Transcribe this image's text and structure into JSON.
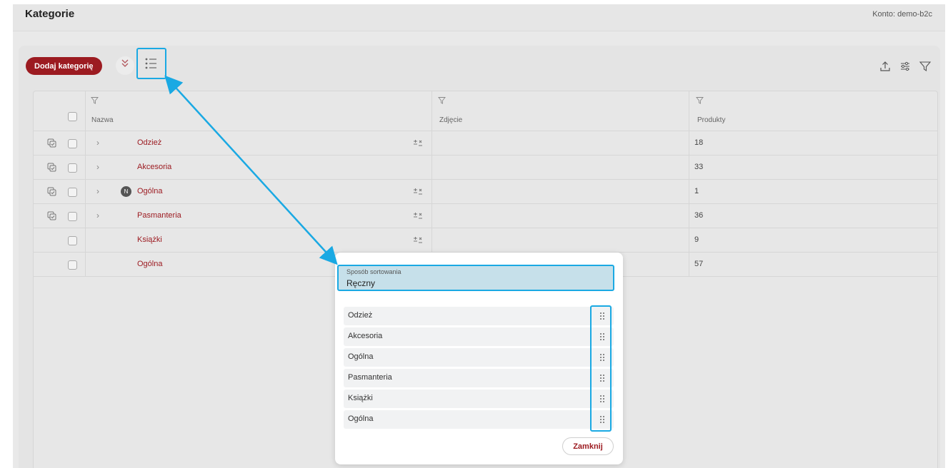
{
  "header": {
    "title": "Kategorie",
    "account": "Konto: demo-b2c"
  },
  "toolbar": {
    "add_label": "Dodaj kategorię",
    "icons": [
      "double-chevron-down-icon",
      "sort-list-icon",
      "upload-icon",
      "sliders-icon",
      "filter-icon"
    ]
  },
  "table": {
    "columns": [
      "Nazwa",
      "Zdjęcie",
      "Produkty"
    ],
    "rows": [
      {
        "name": "Odzież",
        "products": "18",
        "expandable": true,
        "copy": true,
        "attr": true,
        "badge": ""
      },
      {
        "name": "Akcesoria",
        "products": "33",
        "expandable": true,
        "copy": true,
        "attr": false,
        "badge": ""
      },
      {
        "name": "Ogólna",
        "products": "1",
        "expandable": true,
        "copy": true,
        "attr": true,
        "badge": "N"
      },
      {
        "name": "Pasmanteria",
        "products": "36",
        "expandable": true,
        "copy": true,
        "attr": true,
        "badge": ""
      },
      {
        "name": "Książki",
        "products": "9",
        "expandable": false,
        "copy": false,
        "attr": true,
        "badge": ""
      },
      {
        "name": "Ogólna",
        "products": "57",
        "expandable": false,
        "copy": false,
        "attr": false,
        "badge": ""
      }
    ]
  },
  "modal": {
    "sort_label": "Sposób sortowania",
    "sort_value": "Ręczny",
    "items": [
      "Odzież",
      "Akcesoria",
      "Ogólna",
      "Pasmanteria",
      "Książki",
      "Ogólna"
    ],
    "close_label": "Zamknij"
  },
  "colors": {
    "brand": "#9c1b21",
    "highlight": "#1aa9e3"
  }
}
